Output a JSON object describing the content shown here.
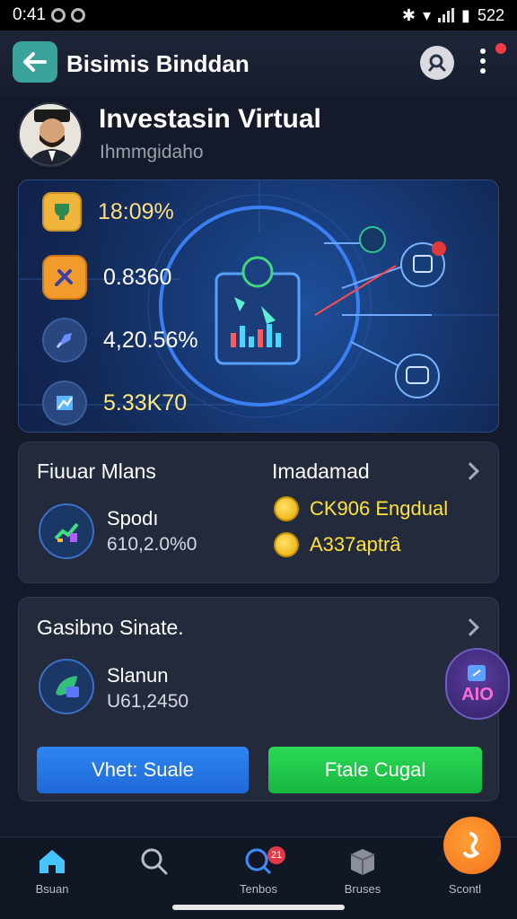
{
  "status": {
    "time": "0:41",
    "battery": "522"
  },
  "header": {
    "title": "Bisimis Binddan"
  },
  "profile": {
    "title": "Investasin Virtual",
    "subtitle": "Ihmmgidaho"
  },
  "hero": {
    "stats": [
      {
        "icon": "trophy-icon",
        "value": "18:09%"
      },
      {
        "icon": "tools-icon",
        "value": "0.8360"
      },
      {
        "icon": "rocket-icon",
        "value": "4,20.56%"
      },
      {
        "icon": "chart-icon",
        "value": "5.33K70"
      }
    ]
  },
  "card1": {
    "title": "Fiuuar Mlans",
    "right_title": "Imadamad",
    "item_label": "Spodı",
    "item_value": "610,2.0%0",
    "coins": [
      "CK906 Engdual",
      "A337aptrâ"
    ]
  },
  "card2": {
    "title": "Gasibno Sinate.",
    "item_label": "Slanun",
    "item_value": "U61,2450",
    "btn_left": "Vhet: Suale",
    "btn_right": "Ftale Cugal"
  },
  "badge": {
    "text": "AIO"
  },
  "nav": {
    "badge": "21",
    "items": [
      {
        "label": "Bsuan",
        "icon": "home-icon"
      },
      {
        "label": "",
        "icon": "search-icon"
      },
      {
        "label": "Tenbos",
        "icon": "chat-search-icon"
      },
      {
        "label": "Bruses",
        "icon": "box-icon"
      },
      {
        "label": "Scontl",
        "icon": "profile-icon"
      }
    ]
  },
  "colors": {
    "accent_teal": "#3aa39c",
    "coin_text": "#ffe23b",
    "green_button": "#17b73e",
    "blue_button": "#1f69d7"
  }
}
